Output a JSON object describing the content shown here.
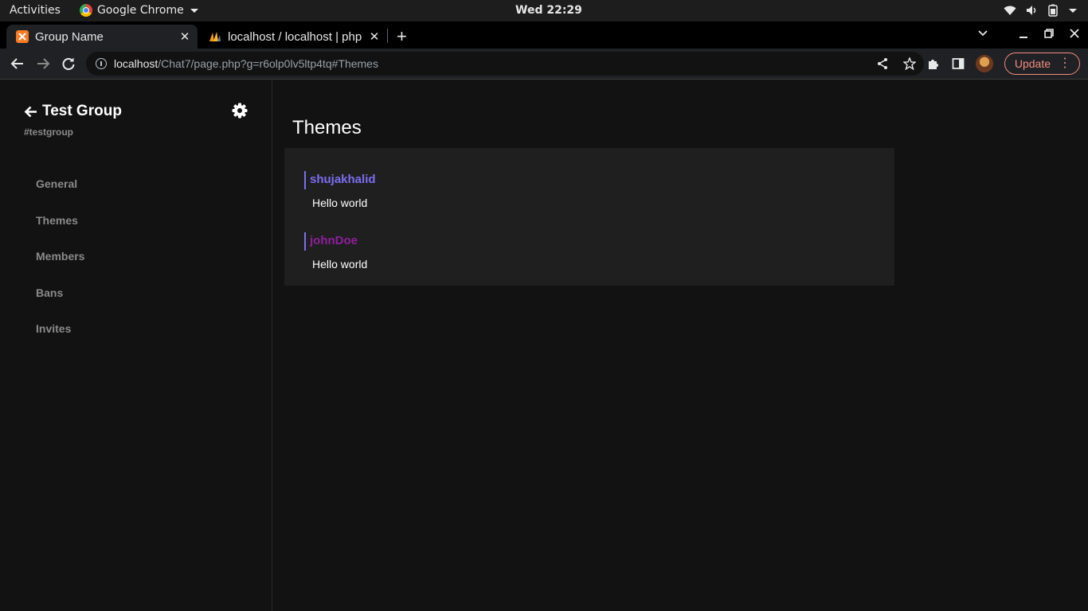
{
  "system_bar": {
    "activities": "Activities",
    "app_name": "Google Chrome",
    "clock": "Wed 22:29"
  },
  "tabs": [
    {
      "title": "Group Name",
      "active": true
    },
    {
      "title": "localhost / localhost | php",
      "active": false
    }
  ],
  "address_bar": {
    "host": "localhost",
    "path": "/Chat7/page.php?g=r6olp0lv5ltp4tq#Themes"
  },
  "toolbar": {
    "update_label": "Update"
  },
  "sidebar": {
    "group_name": "Test Group",
    "group_tag": "#testgroup",
    "items": [
      {
        "label": "General"
      },
      {
        "label": "Themes"
      },
      {
        "label": "Members"
      },
      {
        "label": "Bans"
      },
      {
        "label": "Invites"
      }
    ]
  },
  "main": {
    "title": "Themes",
    "messages": [
      {
        "user": "shujakhalid",
        "text": "Hello world",
        "color": "#7b6ff0"
      },
      {
        "user": "johnDoe",
        "text": "Hello world",
        "color": "#8e1f9c"
      }
    ]
  },
  "colors": {
    "page_bg": "#121212",
    "panel_bg": "#1f1f1f",
    "update_accent": "#f28b82"
  }
}
